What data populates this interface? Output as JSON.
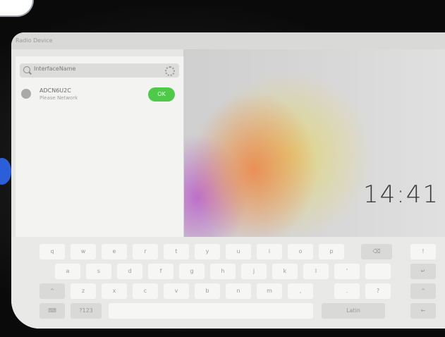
{
  "statusbar": {
    "title": "Radio Device"
  },
  "clock": "14:41",
  "panel": {
    "search": {
      "text": "InterfaceName"
    },
    "device": {
      "name": "ADCN6U2C",
      "subtitle": "Please Network",
      "action_label": "OK"
    }
  },
  "keyboard": {
    "row1": [
      "q",
      "w",
      "e",
      "r",
      "t",
      "y",
      "u",
      "i",
      "o",
      "p",
      "⌫",
      "!"
    ],
    "row2": [
      "a",
      "s",
      "d",
      "f",
      "g",
      "h",
      "j",
      "k",
      "l",
      "'",
      "",
      "↵"
    ],
    "row3": [
      "^",
      "z",
      "x",
      "c",
      "v",
      "b",
      "n",
      "m",
      ",",
      ".",
      "?",
      "^"
    ],
    "row4": [
      "⌨",
      "?123",
      "",
      "",
      "",
      "",
      "",
      "",
      "",
      "",
      "",
      "←"
    ],
    "space_label": "Latin",
    "sym_label": "?123"
  },
  "colors": {
    "accent": "#4fc94a",
    "bezel": "#0a0a0a",
    "indicator": "#2b5fd9"
  }
}
